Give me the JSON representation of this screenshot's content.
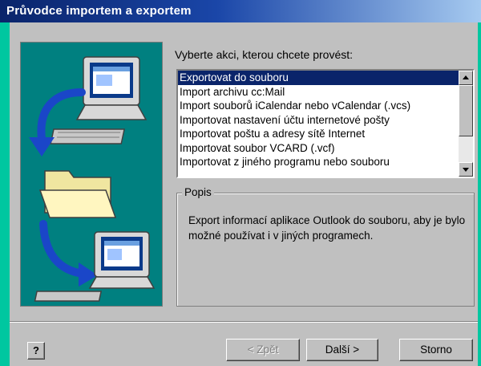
{
  "window": {
    "title": "Průvodce importem a exportem"
  },
  "prompt": "Vyberte akci, kterou chcete provést:",
  "actions": {
    "selected_index": 0,
    "items": [
      "Exportovat do souboru",
      "Import archivu cc:Mail",
      "Import souborů iCalendar nebo vCalendar (.vcs)",
      "Importovat nastavení účtu internetové pošty",
      "Importovat poštu a adresy sítě Internet",
      "Importovat soubor VCARD (.vcf)",
      "Importovat z jiného programu nebo souboru"
    ]
  },
  "description": {
    "legend": "Popis",
    "text": "Export informací aplikace Outlook do souboru, aby je bylo možné používat i v jiných programech."
  },
  "buttons": {
    "help": "?",
    "back": "< Zpět",
    "next": "Další >",
    "cancel": "Storno"
  },
  "colors": {
    "title_bar": "#0a246a",
    "selection": "#0a246a",
    "art_background": "#008080",
    "desktop": "#00c7a0"
  },
  "icons": [
    "computer-icon",
    "folder-icon",
    "arrow-icon",
    "help-icon"
  ]
}
